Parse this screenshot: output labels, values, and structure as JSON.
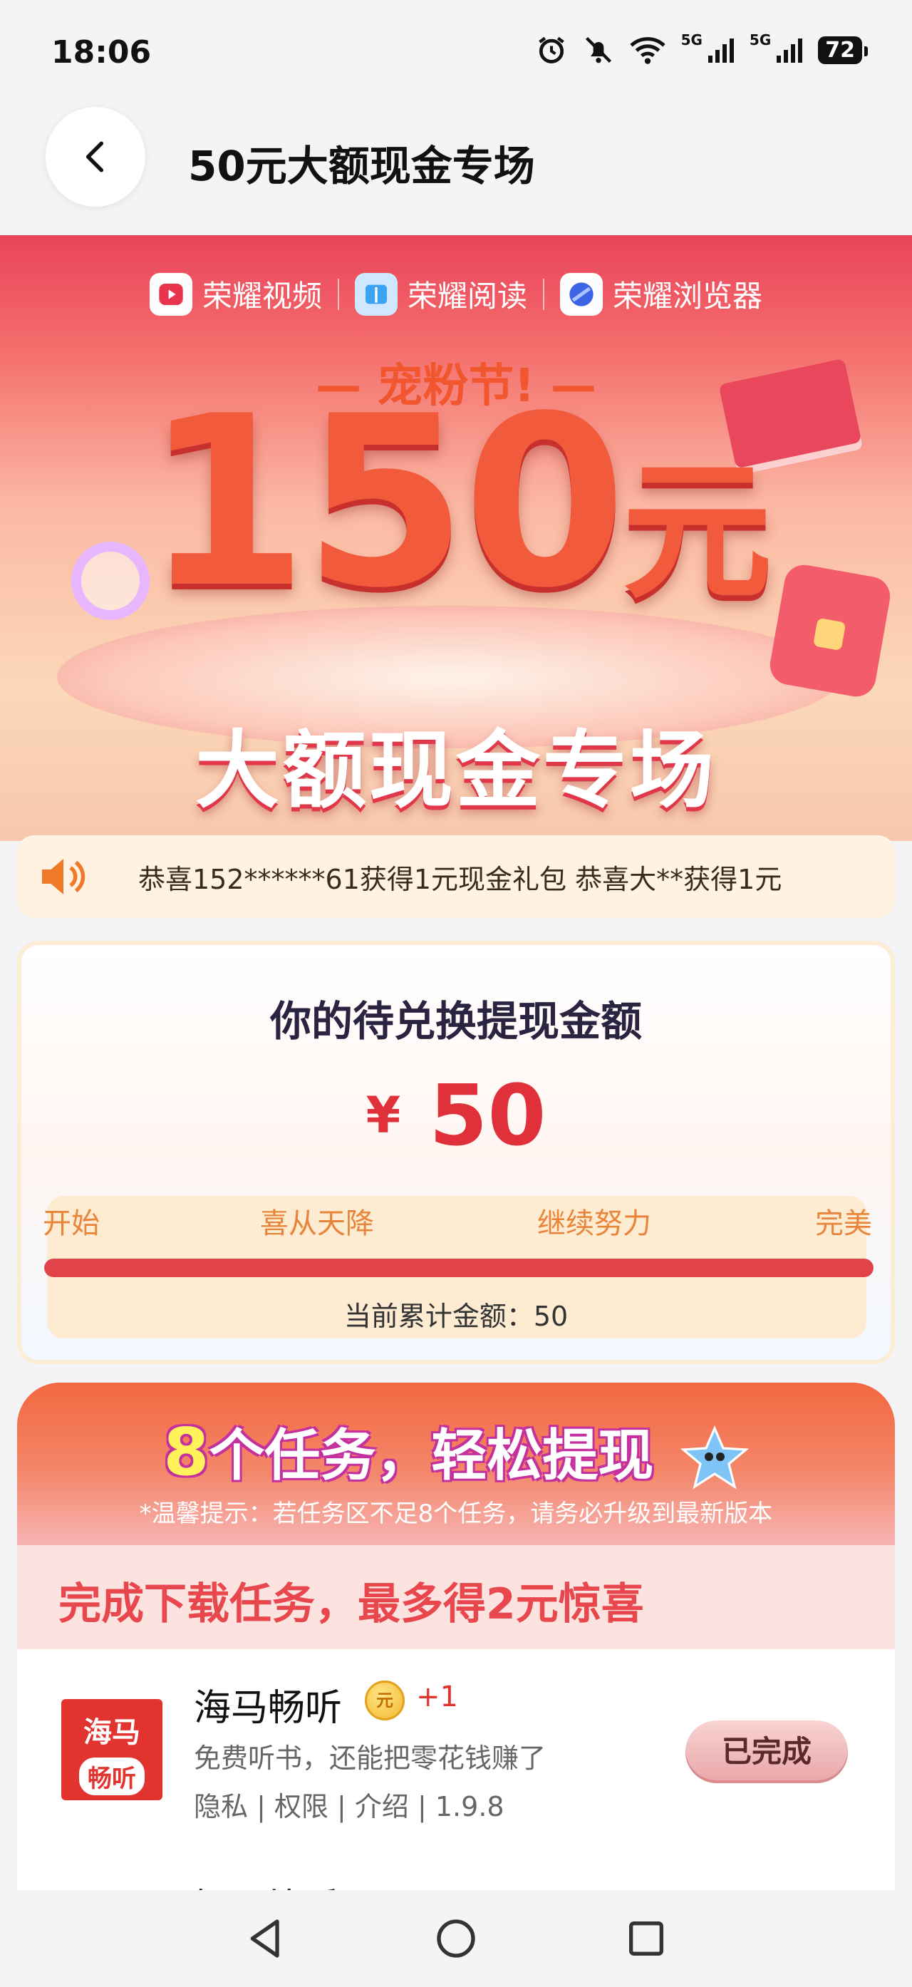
{
  "status_bar": {
    "time": "18:06",
    "network_1": "5G",
    "network_2": "5G",
    "battery": "72",
    "icons": [
      "alarm-icon",
      "mute-icon",
      "wifi-icon",
      "signal-icon",
      "signal-icon",
      "battery-icon"
    ]
  },
  "header": {
    "title": "50元大额现金专场",
    "back_icon": "chevron-left-icon"
  },
  "banner": {
    "brands": [
      "荣耀视频",
      "荣耀阅读",
      "荣耀浏览器"
    ],
    "festival": "宠粉节!",
    "amount": "150",
    "amount_unit": "元",
    "subtitle": "大额现金专场"
  },
  "marquee": {
    "icon": "speaker-icon",
    "text": "恭喜152******61获得1元现金礼包   恭喜大**获得1元"
  },
  "amount_card": {
    "title": "你的待兑换提现金额",
    "currency": "¥",
    "value": "50",
    "stages": [
      "开始",
      "喜从天降",
      "继续努力",
      "完美"
    ],
    "progress": 1.0,
    "accumulated": "当前累计金额：50"
  },
  "tasks": {
    "title_num": "8",
    "title_rest": "个任务，轻松提现",
    "tip": "*温馨提示：若任务区不足8个任务，请务必升级到最新版本",
    "download_banner": "完成下载任务，最多得2元惊喜",
    "items": [
      {
        "icon_line1": "海马",
        "icon_line2": "畅听",
        "name": "海马畅听",
        "coin": "元",
        "reward": "+1",
        "desc": "免费听书，还能把零花钱赚了",
        "meta": "隐私 | 权限 | 介绍 | 1.9.8",
        "button": "已完成"
      }
    ],
    "next_item_partial": "知了比香"
  },
  "colors": {
    "accent": "#e0303a",
    "banner_red": "#e9445a",
    "stage_orange": "#e8853a"
  }
}
